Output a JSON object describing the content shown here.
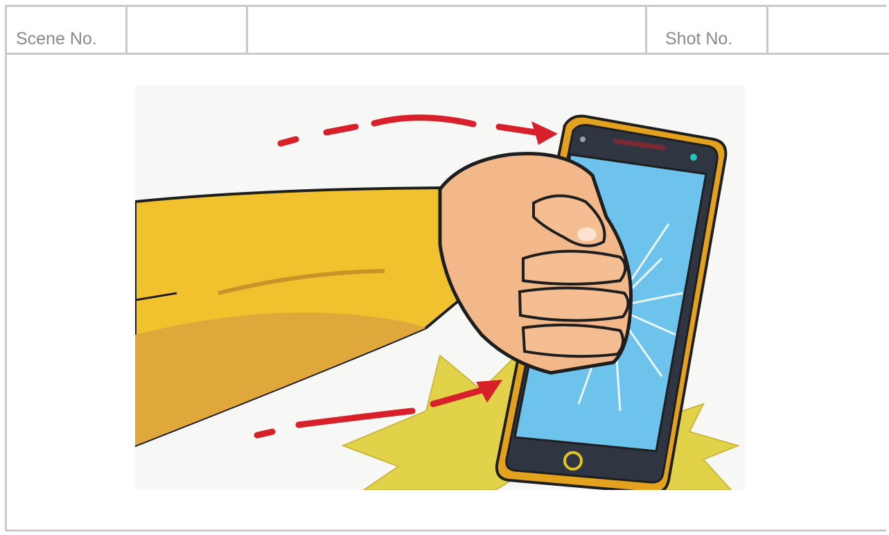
{
  "header": {
    "scene_label": "Scene No.",
    "scene_value": "",
    "shot_label": "Shot No.",
    "shot_value": ""
  },
  "panel": {
    "illustration": "fist-punching-smartphone-illustration",
    "accent_color": "#d8202a",
    "sleeve_color": "#f2c12e",
    "phone_frame_color": "#e0a020",
    "screen_color": "#6ec3ec"
  }
}
